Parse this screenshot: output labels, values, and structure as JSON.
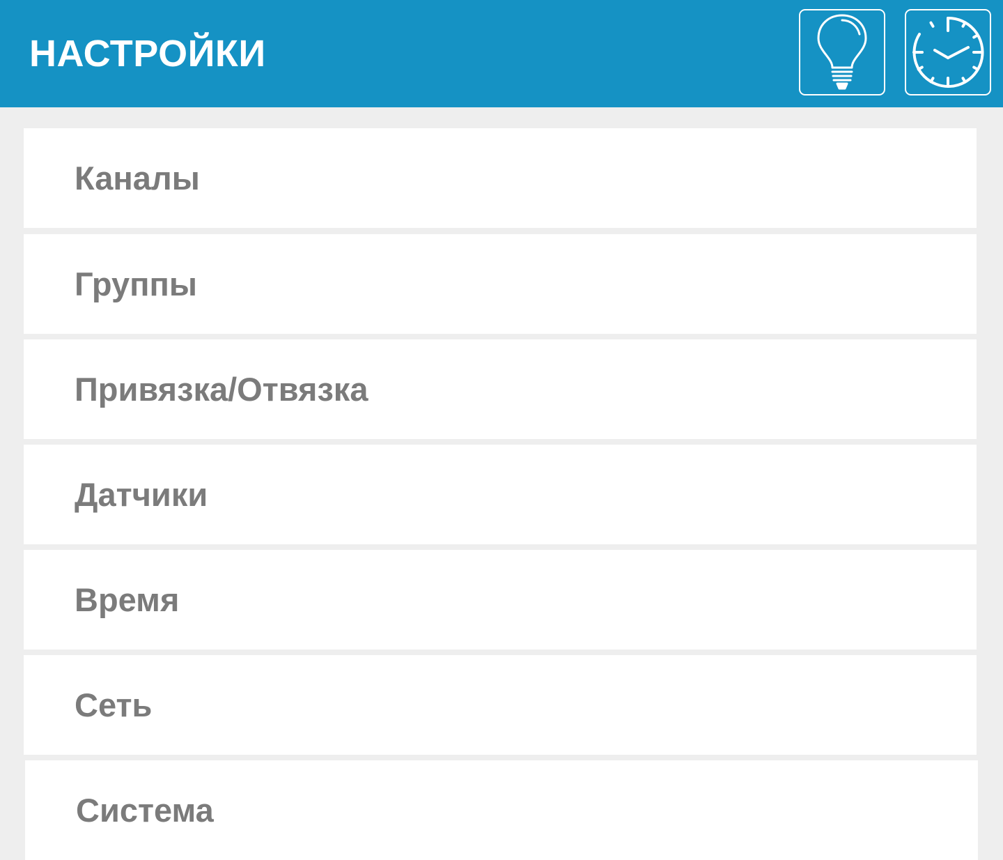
{
  "header": {
    "title": "НАСТРОЙКИ",
    "background_color": "#1592c4",
    "buttons": [
      {
        "icon": "lightbulb-icon"
      },
      {
        "icon": "clock-icon"
      }
    ]
  },
  "menu": {
    "text_color": "#7b7b7b",
    "items": [
      {
        "label": "Каналы"
      },
      {
        "label": "Группы"
      },
      {
        "label": "Привязка/Отвязка"
      },
      {
        "label": "Датчики"
      },
      {
        "label": "Время"
      },
      {
        "label": "Сеть"
      },
      {
        "label": "Система"
      }
    ]
  }
}
